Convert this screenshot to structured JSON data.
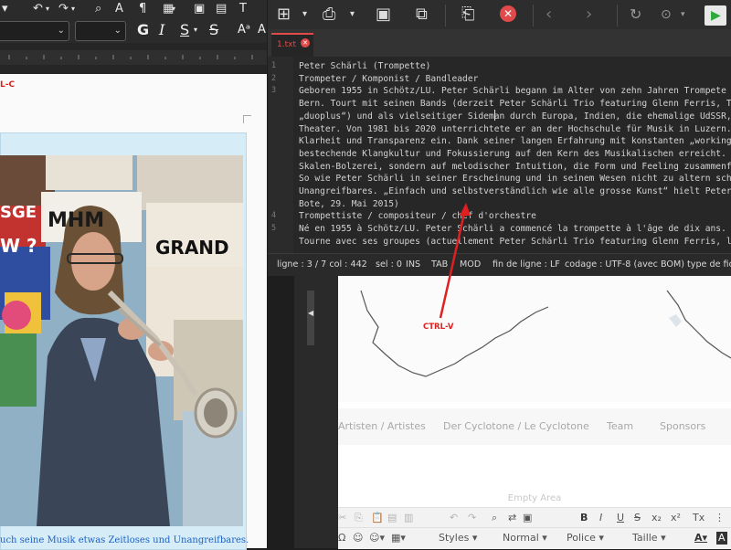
{
  "word_processor": {
    "red_label": "L-C",
    "font_style_bold": "G",
    "font_style_italic": "I",
    "font_style_underline": "S",
    "font_style_strike": "S",
    "caption": "uch seine Musik etwas Zeitloses und Unangreifbares.",
    "poster_texts": {
      "mhm": "MHM",
      "grand": "GRAND",
      "sge": "SGE",
      "wq": "W ?"
    }
  },
  "text_editor": {
    "tab_label": "1.txt",
    "lines": [
      {
        "num": "1",
        "text": "Peter Schärli (Trompette)"
      },
      {
        "num": "2",
        "text": "Trompeter / Komponist / Bandleader"
      },
      {
        "num": "3",
        "text": "Geboren 1955 in Schötz/LU. Peter Schärli begann im Alter von zehn Jahren Trompete"
      },
      {
        "num": "",
        "text": "Bern. Tourt mit seinen Bands (derzeit Peter Schärli Trio featuring Glenn Ferris, T"
      },
      {
        "num": "",
        "text": "„duoplus“) und als vielseitiger Sideman durch Europa, Indien, die ehemalige UdSSR,"
      },
      {
        "num": "",
        "text": "Theater. Von 1981 bis 2020 unterrichtete er an der Hochschule für Musik in Luzern."
      },
      {
        "num": "",
        "text": "Klarheit und Transparenz ein. Dank seiner langen Erfahrung mit konstanten „working"
      },
      {
        "num": "",
        "text": "bestechende Klangkultur und Fokussierung auf den Kern des Musikalischen erreicht."
      },
      {
        "num": "",
        "text": "Skalen-Bolzerei, sondern auf melodischer Intuition, die Form und Feeling zusammenf"
      },
      {
        "num": "",
        "text": "So wie Peter Schärli in seiner Erscheinung und in seinem Wesen nicht zu altern sch"
      },
      {
        "num": "",
        "text": "Unangreifbares. „Einfach und selbstverständlich wie alle grosse Kunst“ hielt Peter"
      },
      {
        "num": "",
        "text": "Bote, 29. Mai 2015)"
      },
      {
        "num": "4",
        "text": "Trompettiste / compositeur / chef d'orchestre"
      },
      {
        "num": "5",
        "text": "Né en 1955 à Schötz/LU. Peter Schärli a commencé la trompette à l'âge de dix ans."
      },
      {
        "num": "",
        "text": "Tourne avec ses groupes (actuellement Peter Schärli Trio featuring Glenn Ferris, l"
      }
    ],
    "status": {
      "line_col": "ligne : 3 / 7  col : 442",
      "sel": "sel : 0",
      "ins": "INS",
      "tab": "TAB",
      "mod": "MOD",
      "eol": "fin de ligne : LF",
      "encoding": "codage : UTF-8 (avec BOM)",
      "filetype": "type de fic"
    }
  },
  "annotation": {
    "label": "CTRL-V",
    "color": "#e02020"
  },
  "website_editor": {
    "nav_items": [
      "Artisten / Artistes",
      "Der Cyclotone / Le Cyclotone",
      "Team",
      "Sponsors"
    ],
    "empty_area": "Empty Area",
    "toolbar2": {
      "styles": "Styles",
      "format": "Normal",
      "font": "Police",
      "size": "Taille"
    }
  }
}
